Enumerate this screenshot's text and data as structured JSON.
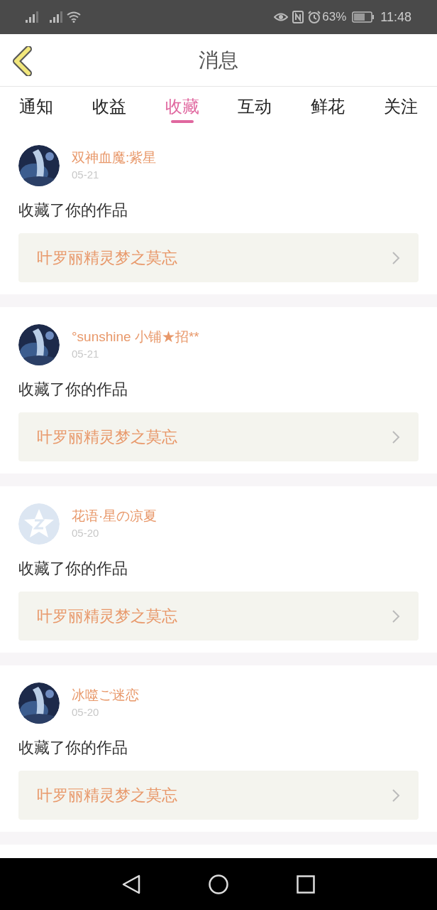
{
  "status_bar": {
    "battery": "63%",
    "time": "11:48"
  },
  "header": {
    "title": "消息"
  },
  "tabs": [
    {
      "label": "通知",
      "selected": false
    },
    {
      "label": "收益",
      "selected": false
    },
    {
      "label": "收藏",
      "selected": true
    },
    {
      "label": "互动",
      "selected": false
    },
    {
      "label": "鲜花",
      "selected": false
    },
    {
      "label": "关注",
      "selected": false
    }
  ],
  "messages": [
    {
      "user": "双神血魔:紫星",
      "date": "05-21",
      "text": "收藏了你的作品",
      "work": "叶罗丽精灵梦之莫忘"
    },
    {
      "user": "°sunshine 小铺★招**",
      "date": "05-21",
      "text": "收藏了你的作品",
      "work": "叶罗丽精灵梦之莫忘"
    },
    {
      "user": "花语·星の凉夏",
      "date": "05-20",
      "avatar": {
        "kind": "default"
      },
      "text": "收藏了你的作品",
      "work": "叶罗丽精灵梦之莫忘"
    },
    {
      "user": "冰噬ご迷恋",
      "date": "05-20",
      "text": "收藏了你的作品",
      "work": "叶罗丽精灵梦之莫忘"
    }
  ]
}
